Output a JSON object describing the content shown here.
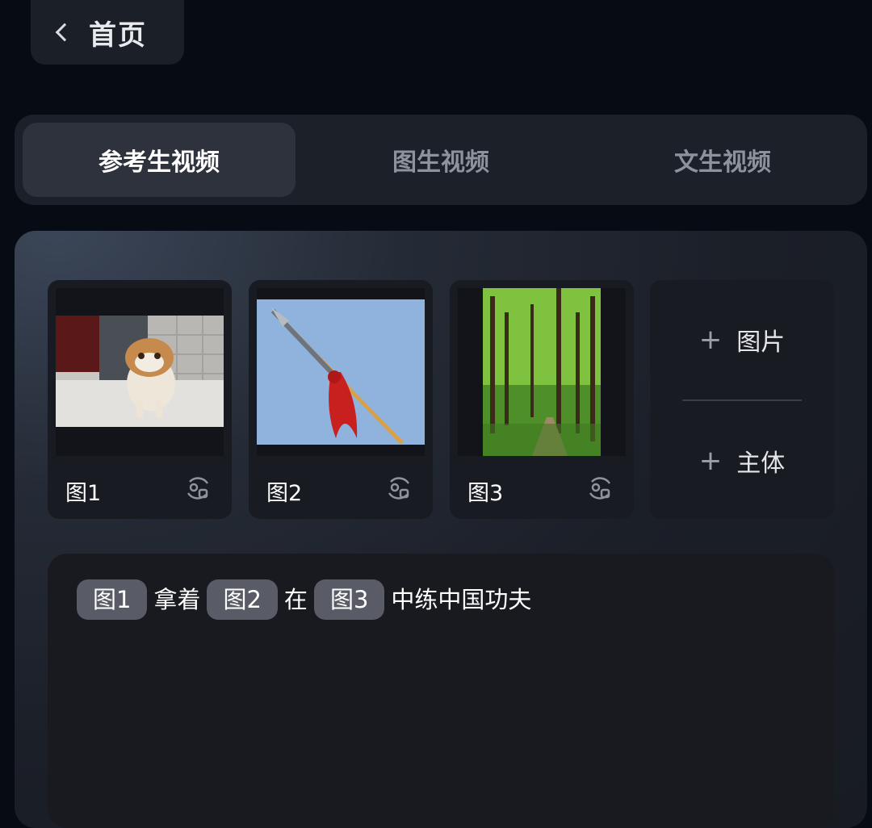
{
  "header": {
    "back_label": "首页"
  },
  "tabs": [
    {
      "label": "参考生视频",
      "active": true
    },
    {
      "label": "图生视频",
      "active": false
    },
    {
      "label": "文生视频",
      "active": false
    }
  ],
  "references": [
    {
      "label": "图1",
      "image": "cat-photo"
    },
    {
      "label": "图2",
      "image": "red-tassel-spear-photo"
    },
    {
      "label": "图3",
      "image": "forest-path-photo"
    }
  ],
  "add_panel": {
    "add_image_label": "图片",
    "add_subject_label": "主体"
  },
  "prompt": {
    "parts": [
      {
        "type": "chip",
        "text": "图1"
      },
      {
        "type": "text",
        "text": "拿着"
      },
      {
        "type": "chip",
        "text": "图2"
      },
      {
        "type": "text",
        "text": "在"
      },
      {
        "type": "chip",
        "text": "图3"
      },
      {
        "type": "text",
        "text": "中练中国功夫"
      }
    ]
  }
}
